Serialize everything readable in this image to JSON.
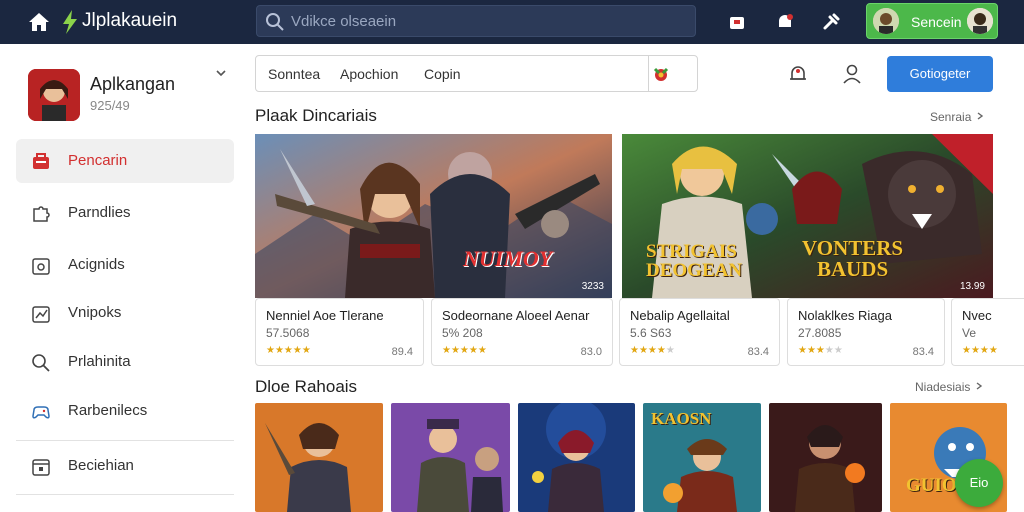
{
  "topbar": {
    "app_title": "Jlplakauein",
    "search_placeholder": "Vdikce olseaein",
    "user_label": "Sencein"
  },
  "sidebar": {
    "app_name": "Aplkangan",
    "app_sub": "925/49",
    "items": [
      {
        "label": "Pencarin",
        "icon": "store-icon",
        "active": true
      },
      {
        "label": "Parndlies",
        "icon": "puzzle-icon"
      },
      {
        "label": "Acignids",
        "icon": "tablet-icon"
      },
      {
        "label": "Vnipoks",
        "icon": "chart-icon"
      },
      {
        "label": "Prlahinita",
        "icon": "search-icon"
      },
      {
        "label": "Rarbenilecs",
        "icon": "gamepad-icon"
      },
      {
        "label": "Beciehian",
        "icon": "calendar-icon"
      }
    ]
  },
  "header": {
    "tabs": [
      "Sonntea",
      "Apochion",
      "Copin"
    ],
    "primary_button": "Gotiogeter"
  },
  "featured": {
    "title": "Plaak Dincariais",
    "link": "Senraia",
    "banners": [
      {
        "logo": "NUIMOY",
        "badge": "3233"
      },
      {
        "logo_top": "STRIGAIS",
        "logo_bottom": "DEOGEAN",
        "logo2_top": "VONTERS",
        "logo2_bottom": "BAUDS",
        "badge": "13.99"
      }
    ],
    "cards": [
      {
        "title": "Nenniel Aoe Tlerane",
        "sub": "57.5068",
        "price": "89.4",
        "rating": 5
      },
      {
        "title": "Sodeornane Aloeel Aenar",
        "sub": "5% 208",
        "price": "83.0",
        "rating": 5
      },
      {
        "title": "Nebalip Agellaital",
        "sub": "5.6 S63",
        "price": "83.4",
        "rating": 4
      },
      {
        "title": "Nolaklkes Riaga",
        "sub": "27.8085",
        "price": "83.4",
        "rating": 3
      },
      {
        "title": "Nvec",
        "sub": "Ve",
        "price": "",
        "rating": 4
      }
    ]
  },
  "recommended": {
    "title": "Dloe Rahoais",
    "link": "Niadesiais",
    "thumb_texts": [
      "",
      "",
      "",
      "KAOSN",
      "",
      "GUIOL"
    ]
  },
  "fab_label": "Eio",
  "colors": {
    "topbar": "#1b2740",
    "accent_green": "#4cb84a",
    "primary_blue": "#2f7ddb",
    "active_red": "#d23030",
    "star": "#e2a713"
  }
}
